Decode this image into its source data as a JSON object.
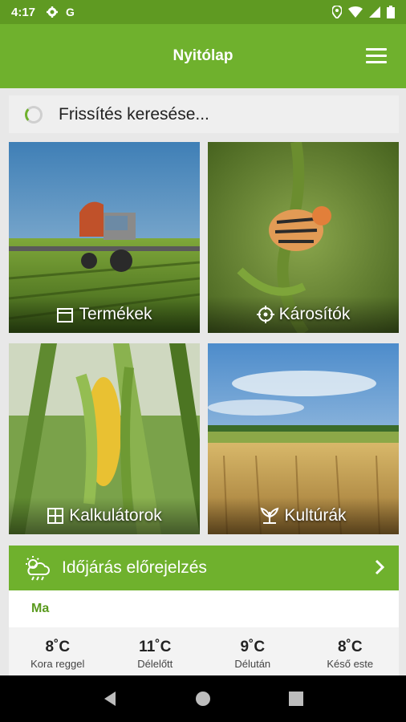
{
  "status_bar": {
    "time": "4:17",
    "icons": [
      "gear-icon",
      "g-icon",
      "location-icon",
      "wifi-icon",
      "signal-icon",
      "battery-icon"
    ],
    "g_label": "G"
  },
  "app_bar": {
    "title": "Nyitólap",
    "menu_icon": "hamburger-menu-icon"
  },
  "refresh": {
    "text": "Frissítés keresése..."
  },
  "tiles": [
    {
      "label": "Termékek",
      "icon": "calendar-icon"
    },
    {
      "label": "Károsítók",
      "icon": "crosshair-icon"
    },
    {
      "label": "Kalkulátorok",
      "icon": "calculator-icon"
    },
    {
      "label": "Kultúrák",
      "icon": "plant-icon"
    }
  ],
  "weather": {
    "title": "Időjárás előrejelzés",
    "day": "Ma",
    "forecast": [
      {
        "temp": "8˚C",
        "label": "Kora reggel"
      },
      {
        "temp": "11˚C",
        "label": "Délelőtt"
      },
      {
        "temp": "9˚C",
        "label": "Délután"
      },
      {
        "temp": "8˚C",
        "label": "Késő este"
      }
    ]
  },
  "colors": {
    "accent": "#6fb12d",
    "status_bar": "#5f9a22",
    "day_text": "#5a9a1e"
  }
}
